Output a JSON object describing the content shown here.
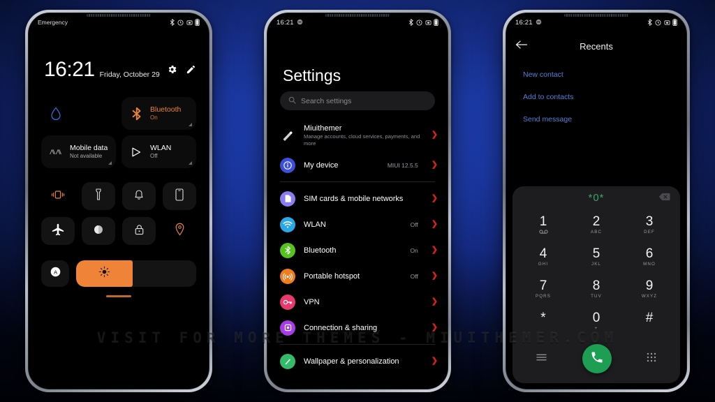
{
  "watermark": "VISIT FOR MORE THEMES - MIUITHEMER.COM",
  "phone1": {
    "statusbar": {
      "emergency": "Emergency",
      "icons": [
        "bluetooth-icon",
        "alarm-icon",
        "screenshot-icon",
        "battery-icon"
      ]
    },
    "clock": {
      "time": "16:21",
      "date": "Friday, October 29",
      "settings_icon": "gear-icon",
      "edit_icon": "pencil-icon"
    },
    "big_tiles": [
      {
        "name": "water-drop",
        "title": "",
        "sub": "",
        "icon": "water-drop-icon",
        "active": false,
        "plain": true
      },
      {
        "name": "bluetooth",
        "title": "Bluetooth",
        "sub": "On",
        "icon": "bluetooth-icon",
        "active": true,
        "plain": false
      },
      {
        "name": "mobile-data",
        "title": "Mobile data",
        "sub": "Not available",
        "icon": "mobile-data-icon",
        "active": false,
        "plain": false
      },
      {
        "name": "wlan",
        "title": "WLAN",
        "sub": "Off",
        "icon": "wlan-icon",
        "active": false,
        "plain": false
      }
    ],
    "small_tiles": [
      {
        "name": "vibrate",
        "icon": "vibrate-icon",
        "active": true,
        "bare": true
      },
      {
        "name": "flashlight",
        "icon": "flashlight-icon",
        "active": false,
        "bare": false
      },
      {
        "name": "ringer",
        "icon": "bell-icon",
        "active": false,
        "bare": false
      },
      {
        "name": "cast",
        "icon": "phone-cast-icon",
        "active": false,
        "bare": false
      },
      {
        "name": "airplane-mode",
        "icon": "airplane-icon",
        "active": false,
        "bare": false
      },
      {
        "name": "dark-mode",
        "icon": "moon-icon",
        "active": false,
        "bare": false
      },
      {
        "name": "screen-lock",
        "icon": "lock-icon",
        "active": false,
        "bare": false
      },
      {
        "name": "location",
        "icon": "location-pin-icon",
        "active": true,
        "bare": true
      }
    ],
    "brightness": {
      "auto_icon": "auto-brightness-icon",
      "slider_icon": "sun-icon",
      "percent": 47,
      "accent": "#ef8338"
    }
  },
  "phone2": {
    "statusbar": {
      "clock": "16:21",
      "left_icon": "dnd-icon",
      "icons": [
        "bluetooth-icon",
        "alarm-icon",
        "screenshot-icon",
        "battery-icon"
      ]
    },
    "title": "Settings",
    "search": {
      "placeholder": "Search settings",
      "icon": "search-icon"
    },
    "items": [
      {
        "name": "miuithemer",
        "label": "Miuithemer",
        "sub": "Manage accounts, cloud services, payments, and more",
        "value": "",
        "icon": "account-icon",
        "icon_color": "transparent",
        "tall": true,
        "divider_after": false
      },
      {
        "name": "my-device",
        "label": "My device",
        "sub": "",
        "value": "MIUI 12.5.5",
        "icon": "info-icon",
        "icon_color": "#3b4fd8",
        "tall": false,
        "divider_after": true
      },
      {
        "name": "sim-cards",
        "label": "SIM cards & mobile networks",
        "sub": "",
        "value": "",
        "icon": "sim-icon",
        "icon_color": "#8a7df0",
        "tall": false,
        "divider_after": false
      },
      {
        "name": "wlan",
        "label": "WLAN",
        "sub": "",
        "value": "Off",
        "icon": "wifi-icon",
        "icon_color": "#2aa7e8",
        "tall": false,
        "divider_after": false
      },
      {
        "name": "bluetooth",
        "label": "Bluetooth",
        "sub": "",
        "value": "On",
        "icon": "bluetooth-icon",
        "icon_color": "#55c21e",
        "tall": false,
        "divider_after": false
      },
      {
        "name": "portable-hotspot",
        "label": "Portable hotspot",
        "sub": "",
        "value": "Off",
        "icon": "hotspot-icon",
        "icon_color": "#f07c1f",
        "tall": false,
        "divider_after": false
      },
      {
        "name": "vpn",
        "label": "VPN",
        "sub": "",
        "value": "",
        "icon": "vpn-key-icon",
        "icon_color": "#e83a6e",
        "tall": false,
        "divider_after": false
      },
      {
        "name": "connection-sharing",
        "label": "Connection & sharing",
        "sub": "",
        "value": "",
        "icon": "share-icon",
        "icon_color": "#a83ae8",
        "tall": false,
        "divider_after": true
      },
      {
        "name": "wallpaper-personalization",
        "label": "Wallpaper & personalization",
        "sub": "",
        "value": "",
        "icon": "brush-icon",
        "icon_color": "#33bb6a",
        "tall": false,
        "divider_after": false
      }
    ],
    "chevron_color": "#e02020"
  },
  "phone3": {
    "statusbar": {
      "clock": "16:21",
      "left_icon": "dnd-icon",
      "icons": [
        "bluetooth-icon",
        "alarm-icon",
        "screenshot-icon",
        "battery-icon"
      ]
    },
    "header": {
      "back_icon": "arrow-left-icon",
      "title": "Recents"
    },
    "links": [
      "New contact",
      "Add to contacts",
      "Send message"
    ],
    "dialer": {
      "number": "*0*",
      "number_color": "#3ea06b",
      "backspace_icon": "backspace-icon",
      "keys": [
        {
          "digit": "1",
          "letters": "voicemail-icon"
        },
        {
          "digit": "2",
          "letters": "ABC"
        },
        {
          "digit": "3",
          "letters": "DEF"
        },
        {
          "digit": "4",
          "letters": "GHI"
        },
        {
          "digit": "5",
          "letters": "JKL"
        },
        {
          "digit": "6",
          "letters": "MNO"
        },
        {
          "digit": "7",
          "letters": "PQRS"
        },
        {
          "digit": "8",
          "letters": "TUV"
        },
        {
          "digit": "9",
          "letters": "WXYZ"
        },
        {
          "digit": "*",
          "letters": ""
        },
        {
          "digit": "0",
          "letters": "+"
        },
        {
          "digit": "#",
          "letters": ""
        }
      ],
      "actions": {
        "menu_icon": "menu-icon",
        "call_icon": "phone-call-icon",
        "call_color": "#1e9e53",
        "keypad_icon": "dialpad-icon"
      }
    }
  }
}
